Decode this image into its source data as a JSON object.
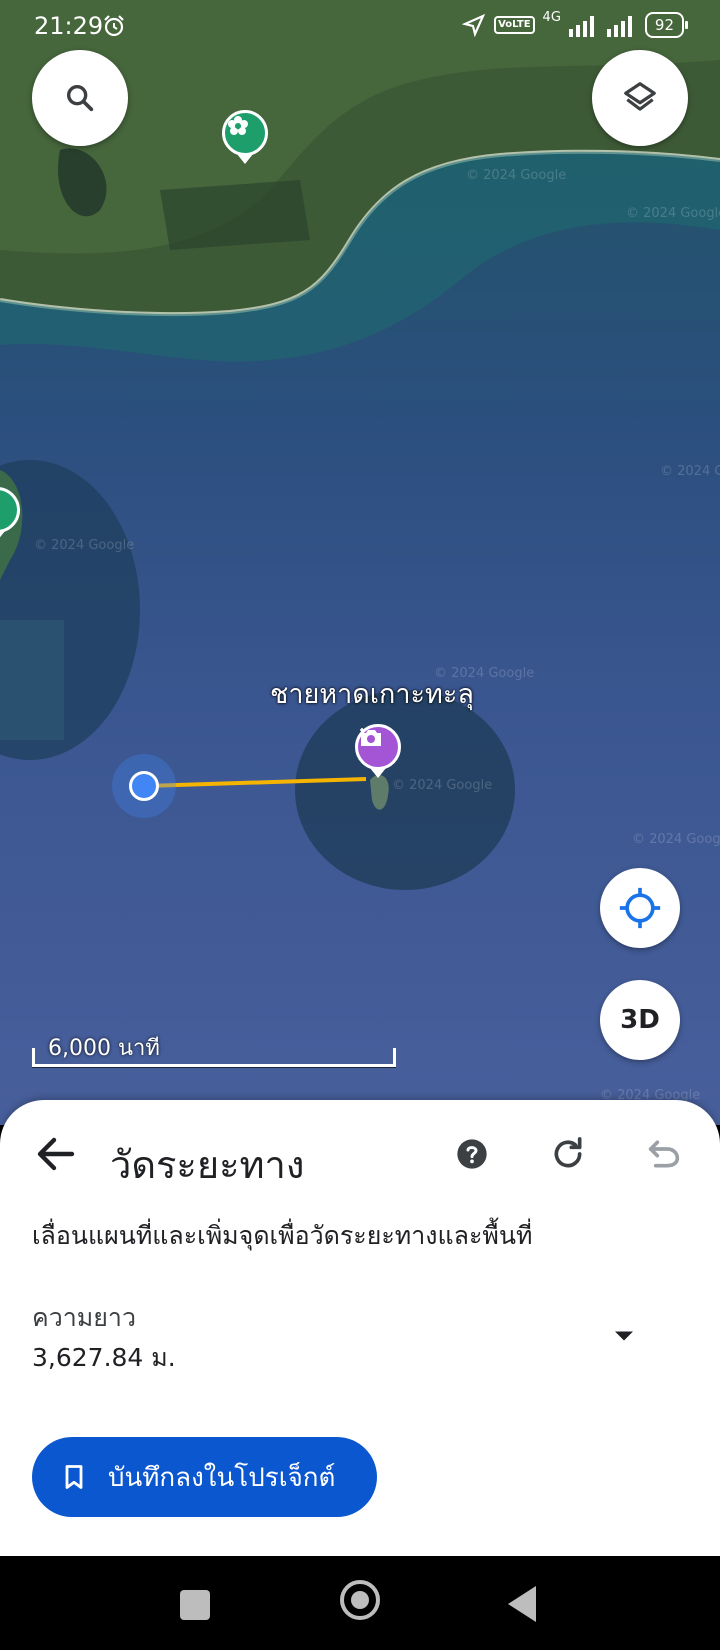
{
  "status_bar": {
    "time": "21:29",
    "battery": "92",
    "network": "4G",
    "volte": "VoLTE"
  },
  "map": {
    "place_label": "ชายหาดเกาะทะลุ",
    "watermark": "© 2024 Google",
    "scale_label": "6,000 นาที",
    "button_3d": "3D"
  },
  "icons": {
    "search": "search-icon",
    "layers": "layers-icon",
    "locate": "my-location-icon",
    "park_pin": "park-pin-icon",
    "photo_pin": "photo-pin-icon",
    "back": "arrow-back-icon",
    "help": "help-icon",
    "refresh": "refresh-icon",
    "undo": "undo-icon",
    "dropdown": "caret-down-icon",
    "bookmark": "bookmark-icon"
  },
  "colors": {
    "accent": "#0b57d0",
    "measure_line": "#f4b400",
    "start_point": "#4285f4",
    "park_pin": "#1e9e6a",
    "photo_pin": "#a455d6"
  },
  "sheet": {
    "title": "วัดระยะทาง",
    "instruction": "เลื่อนแผนที่และเพิ่มจุดเพื่อวัดระยะทางและพื้นที่",
    "length_label": "ความยาว",
    "length_value": "3,627.84 ม.",
    "save_label": "บันทึกลงในโปรเจ็กต์"
  }
}
